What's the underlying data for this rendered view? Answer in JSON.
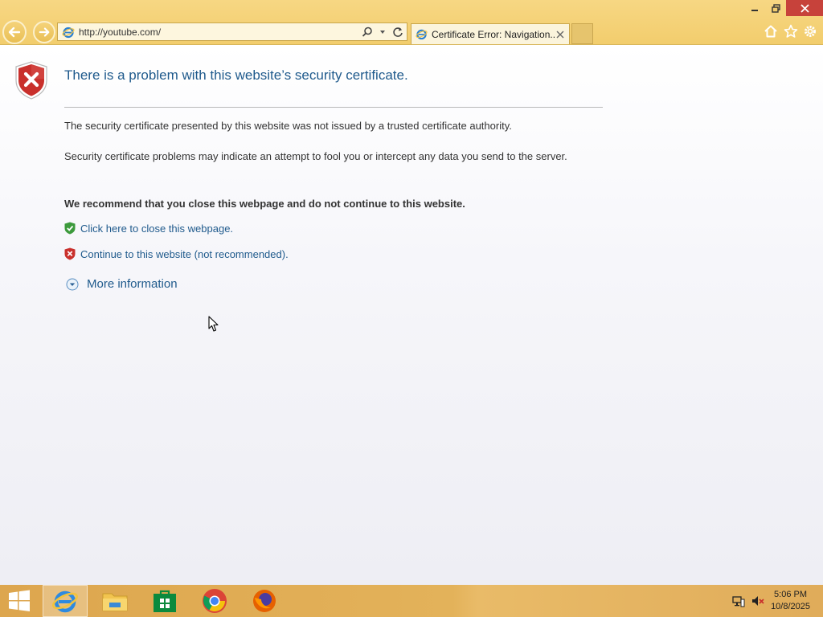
{
  "browser": {
    "address": "http://youtube.com/",
    "tab_title": "Certificate Error: Navigation..."
  },
  "page": {
    "title": "There is a problem with this website’s security certificate.",
    "para1": "The security certificate presented by this website was not issued by a trusted certificate authority.",
    "para2": "Security certificate problems may indicate an attempt to fool you or intercept any data you send to the server.",
    "recommend": "We recommend that you close this webpage and do not continue to this website.",
    "link_close": "Click here to close this webpage.",
    "link_continue": "Continue to this website (not recommended).",
    "more_info": "More information"
  },
  "taskbar": {
    "apps": [
      "start",
      "internet-explorer",
      "file-explorer",
      "store",
      "chrome",
      "firefox"
    ],
    "time": "5:06 PM",
    "date": "10/8/2025"
  },
  "colors": {
    "chrome_bg": "#f2cd6d",
    "link": "#1f5a8c",
    "error_red": "#c7423b",
    "taskbar": "#e3b25a"
  }
}
